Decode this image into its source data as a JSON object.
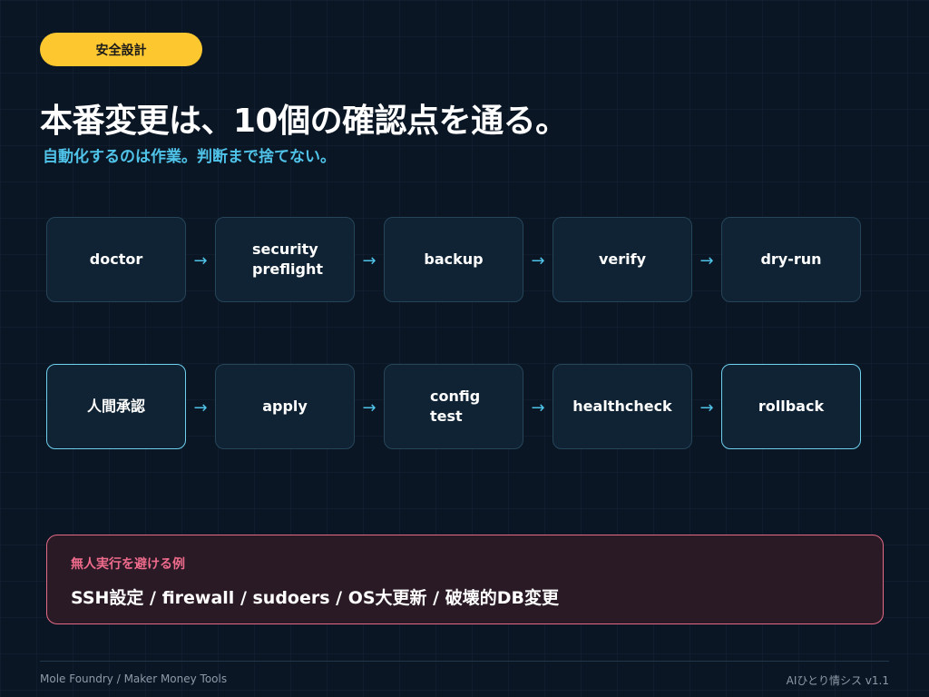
{
  "badge": "安全設計",
  "title": "本番変更は、10個の確認点を通る。",
  "subtitle": "自動化するのは作業。判断まで捨てない。",
  "arrow_glyph": "→",
  "row1": [
    {
      "line1": "doctor",
      "line2": ""
    },
    {
      "line1": "security",
      "line2": "preflight"
    },
    {
      "line1": "backup",
      "line2": ""
    },
    {
      "line1": "verify",
      "line2": ""
    },
    {
      "line1": "dry-run",
      "line2": ""
    }
  ],
  "row2": [
    {
      "line1": "人間承認",
      "line2": ""
    },
    {
      "line1": "apply",
      "line2": ""
    },
    {
      "line1": "config",
      "line2": "test"
    },
    {
      "line1": "healthcheck",
      "line2": ""
    },
    {
      "line1": "rollback",
      "line2": ""
    }
  ],
  "alert": {
    "label": "無人実行を避ける例",
    "text": "SSH設定 / firewall / sudoers / OS大更新 / 破壊的DB変更"
  },
  "footer": {
    "left": "Mole Foundry / Maker Money Tools",
    "right": "AIひとり情シス v1.1"
  },
  "colors": {
    "background": "#0b1624",
    "badge": "#fdc72f",
    "accent": "#4fc3e8",
    "alert_border": "#e46a86",
    "alert_label": "#ef6b8c"
  }
}
